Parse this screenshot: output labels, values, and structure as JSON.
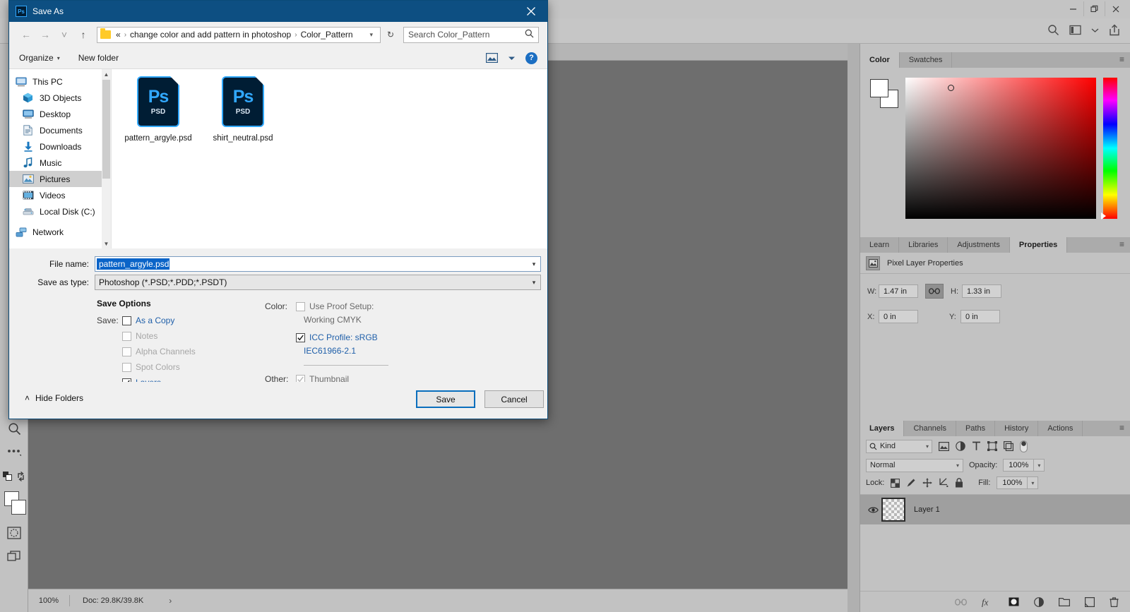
{
  "window": {
    "minimize_label": "Minimize",
    "restore_label": "Restore",
    "close_label": "Close"
  },
  "photoshop": {
    "status": {
      "zoom": "100%",
      "doc": "Doc: 29.8K/39.8K",
      "arrow": "›"
    },
    "color_panel": {
      "tabs": [
        {
          "label": "Color",
          "active": true
        },
        {
          "label": "Swatches",
          "active": false
        }
      ],
      "menu": "≡"
    },
    "properties_panel": {
      "tabs": [
        {
          "label": "Learn",
          "active": false
        },
        {
          "label": "Libraries",
          "active": false
        },
        {
          "label": "Adjustments",
          "active": false
        },
        {
          "label": "Properties",
          "active": true
        }
      ],
      "menu": "≡",
      "header": "Pixel Layer Properties",
      "fields": {
        "w_label": "W:",
        "w_value": "1.47 in",
        "h_label": "H:",
        "h_value": "1.33 in",
        "x_label": "X:",
        "x_value": "0 in",
        "y_label": "Y:",
        "y_value": "0 in",
        "link_label": "∞"
      }
    },
    "layers_panel": {
      "tabs": [
        {
          "label": "Layers",
          "active": true
        },
        {
          "label": "Channels",
          "active": false
        },
        {
          "label": "Paths",
          "active": false
        },
        {
          "label": "History",
          "active": false
        },
        {
          "label": "Actions",
          "active": false
        }
      ],
      "menu": "≡",
      "filter_kind": "Kind",
      "blend_mode": "Normal",
      "opacity_label": "Opacity:",
      "opacity_value": "100%",
      "lock_label": "Lock:",
      "fill_label": "Fill:",
      "fill_value": "100%",
      "layers": [
        {
          "name": "Layer 1",
          "visible": true
        }
      ]
    }
  },
  "dialog": {
    "title": "Save As",
    "app_icon": "Ps",
    "close_icon": "close-icon",
    "nav": {
      "back": "←",
      "forward": "→",
      "recent": "˅",
      "up": "↑",
      "refresh": "↻",
      "breadcrumb_prefix": "«",
      "breadcrumb": [
        "change color and add pattern in photoshop",
        "Color_Pattern"
      ],
      "search_placeholder": "Search Color_Pattern"
    },
    "commands": {
      "organize": "Organize",
      "new_folder": "New folder",
      "help": "?"
    },
    "sidebar": [
      {
        "label": "This PC",
        "icon": "monitor-icon",
        "selected": false,
        "root": true
      },
      {
        "label": "3D Objects",
        "icon": "cube-icon",
        "selected": false
      },
      {
        "label": "Desktop",
        "icon": "desktop-icon",
        "selected": false
      },
      {
        "label": "Documents",
        "icon": "document-icon",
        "selected": false
      },
      {
        "label": "Downloads",
        "icon": "download-icon",
        "selected": false
      },
      {
        "label": "Music",
        "icon": "music-icon",
        "selected": false
      },
      {
        "label": "Pictures",
        "icon": "pictures-icon",
        "selected": true
      },
      {
        "label": "Videos",
        "icon": "video-icon",
        "selected": false
      },
      {
        "label": "Local Disk (C:)",
        "icon": "disk-icon",
        "selected": false
      },
      {
        "label": "Network",
        "icon": "network-icon",
        "selected": false,
        "root": true
      }
    ],
    "files": [
      {
        "name": "pattern_argyle.psd",
        "type": "PSD",
        "badge": "Ps"
      },
      {
        "name": "shirt_neutral.psd",
        "type": "PSD",
        "badge": "Ps"
      }
    ],
    "fields": {
      "file_name_label": "File name:",
      "file_name_value": "pattern_argyle.psd",
      "save_as_type_label": "Save as type:",
      "save_as_type_value": "Photoshop (*.PSD;*.PDD;*.PSDT)"
    },
    "save_options": {
      "title": "Save Options",
      "save_prefix": "Save:",
      "items": [
        {
          "label": "As a Copy",
          "checked": false,
          "enabled": true
        },
        {
          "label": "Notes",
          "checked": false,
          "enabled": false
        },
        {
          "label": "Alpha Channels",
          "checked": false,
          "enabled": false
        },
        {
          "label": "Spot Colors",
          "checked": false,
          "enabled": false
        },
        {
          "label": "Layers",
          "checked": true,
          "enabled": true
        }
      ],
      "color_prefix": "Color:",
      "proof_label": "Use Proof Setup:",
      "proof_sub": "Working CMYK",
      "proof_checked": false,
      "icc_label": "ICC Profile:  sRGB",
      "icc_sub": "IEC61966-2.1",
      "icc_checked": true,
      "other_prefix": "Other:",
      "thumbnail_label": "Thumbnail",
      "thumbnail_checked": true
    },
    "footer": {
      "hide_folders": "Hide Folders",
      "hide_chevron": "˄",
      "save": "Save",
      "cancel": "Cancel"
    }
  }
}
